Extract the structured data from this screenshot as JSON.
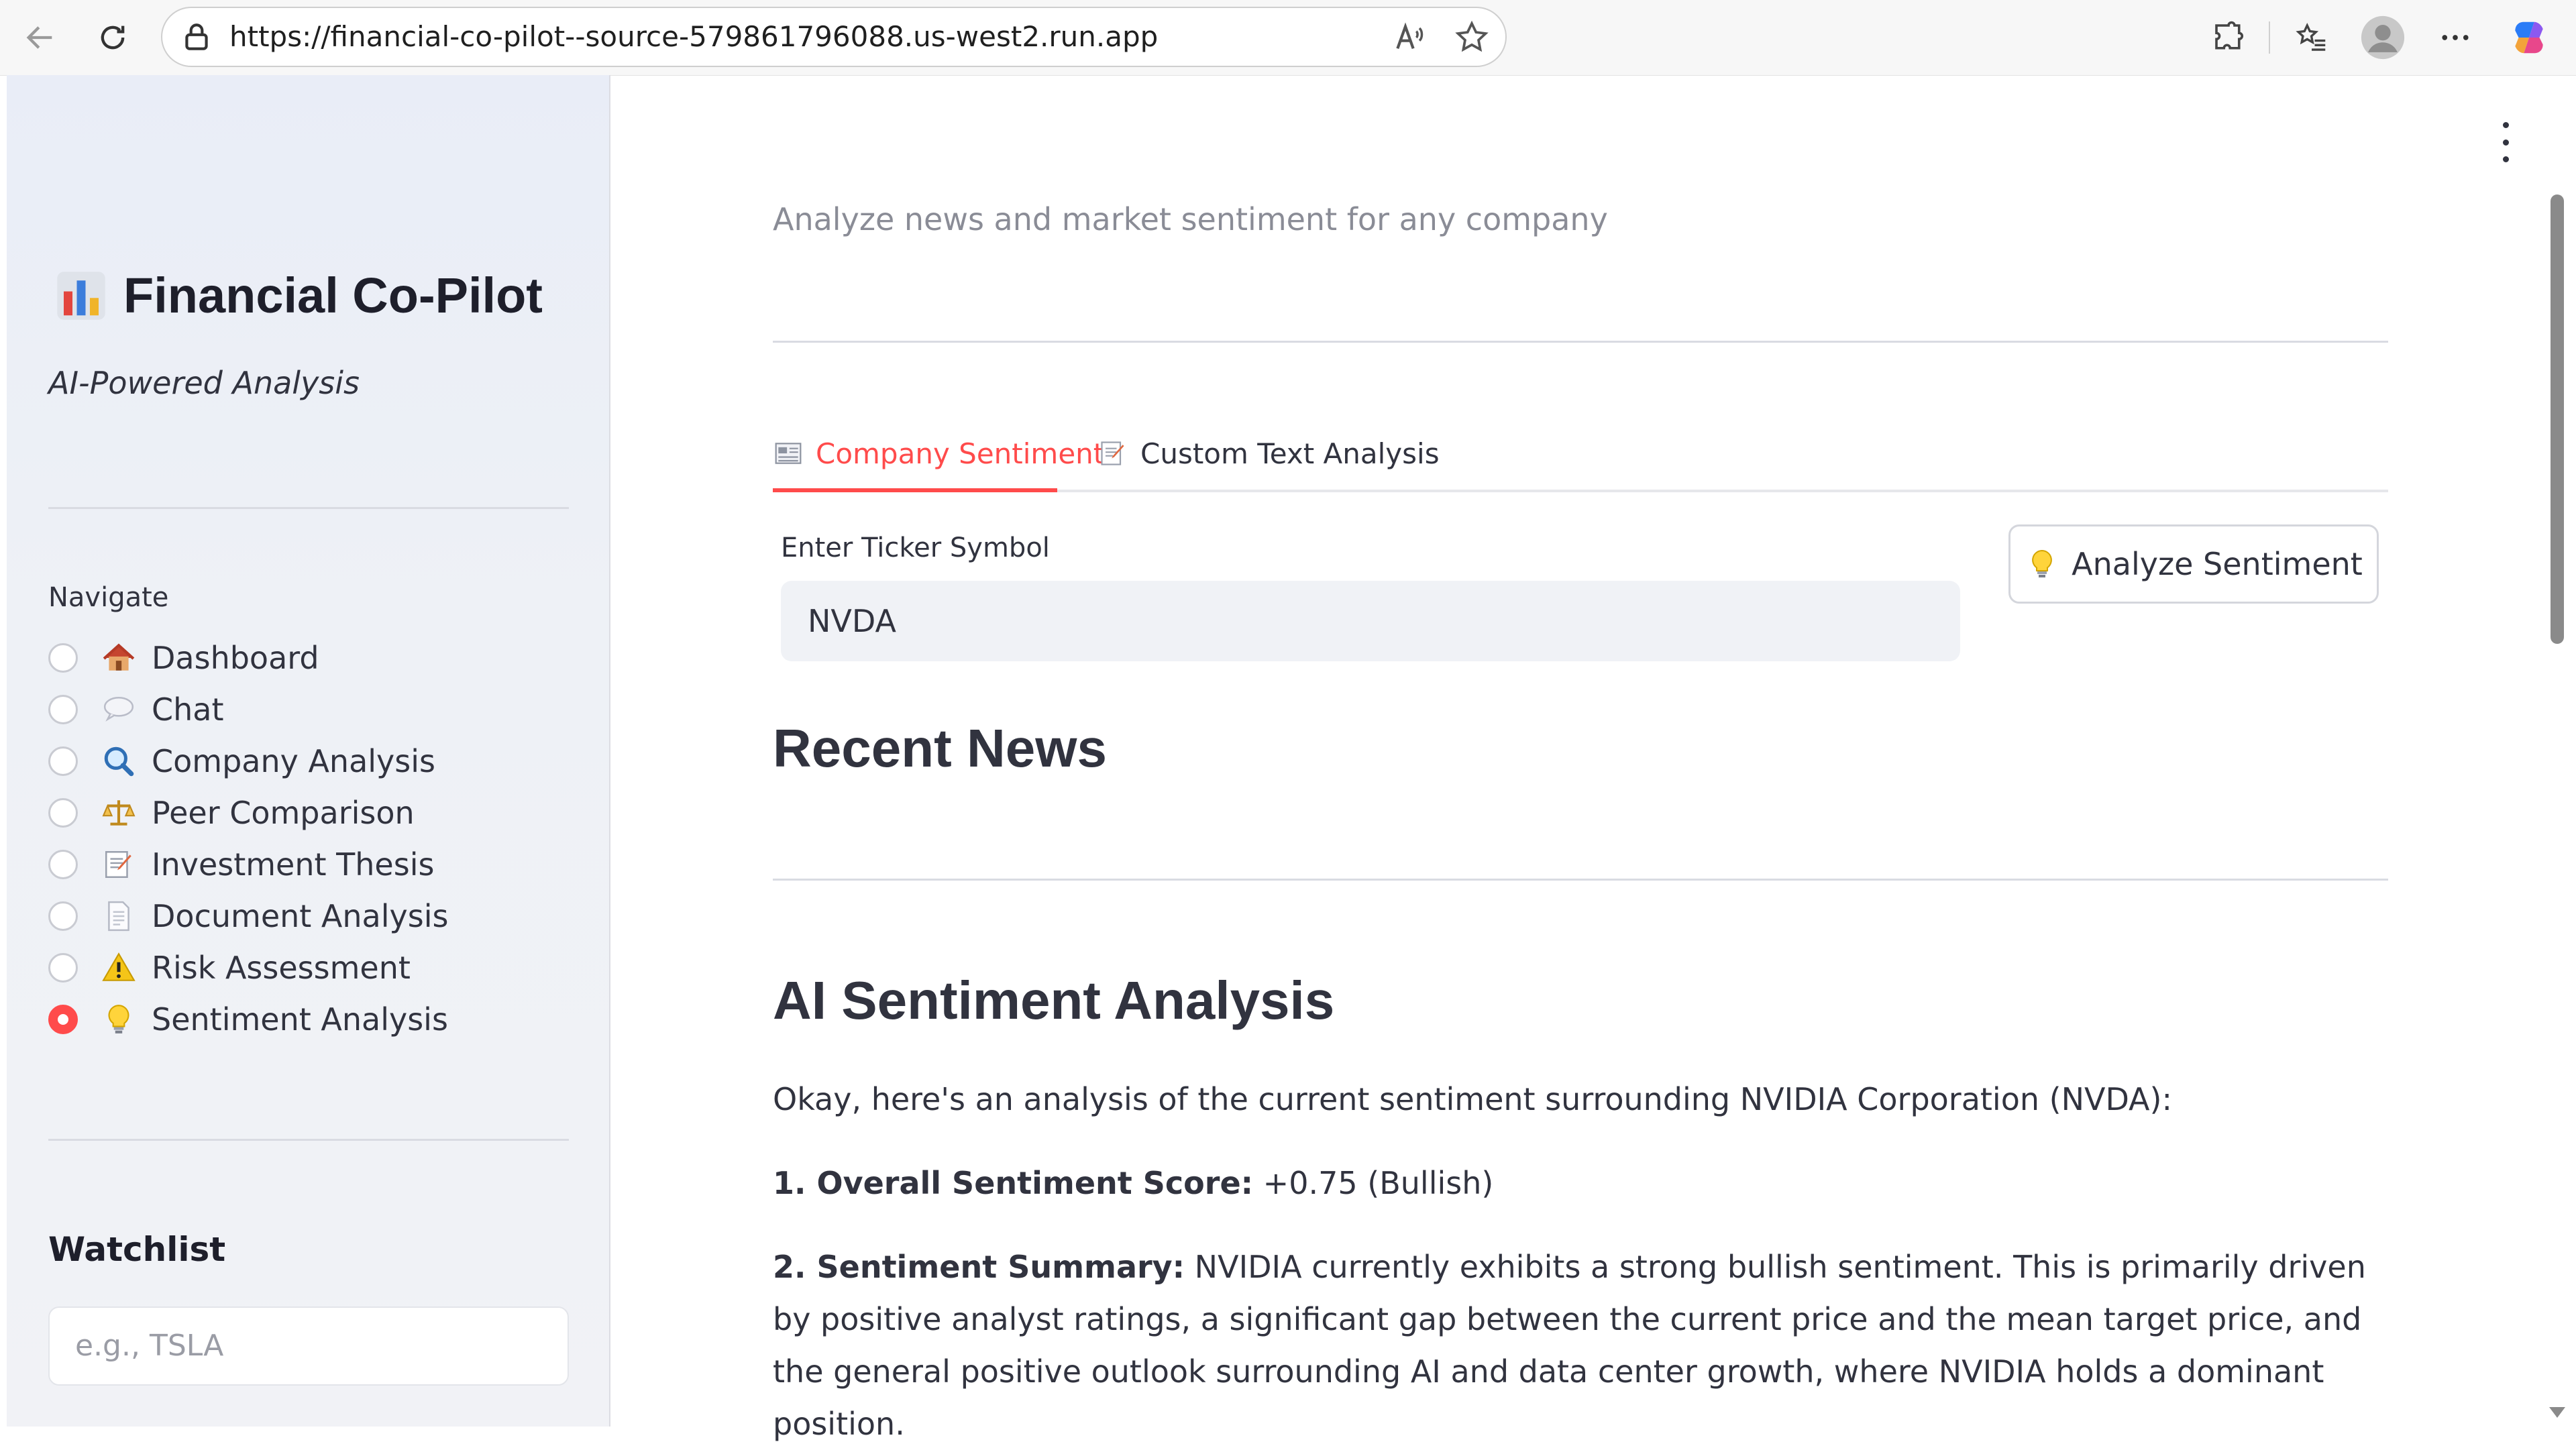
{
  "browser": {
    "url": "https://financial-co-pilot--source-579861796088.us-west2.run.app"
  },
  "sidebar": {
    "brand_title": "Financial Co-Pilot",
    "tagline": "AI-Powered Analysis",
    "nav_label": "Navigate",
    "nav_items": [
      {
        "label": "Dashboard",
        "icon": "house-icon",
        "selected": false
      },
      {
        "label": "Chat",
        "icon": "speech-bubble-icon",
        "selected": false
      },
      {
        "label": "Company Analysis",
        "icon": "magnifier-icon",
        "selected": false
      },
      {
        "label": "Peer Comparison",
        "icon": "scales-icon",
        "selected": false
      },
      {
        "label": "Investment Thesis",
        "icon": "memo-icon",
        "selected": false
      },
      {
        "label": "Document Analysis",
        "icon": "document-icon",
        "selected": false
      },
      {
        "label": "Risk Assessment",
        "icon": "warning-icon",
        "selected": false
      },
      {
        "label": "Sentiment Analysis",
        "icon": "lightbulb-icon",
        "selected": true
      }
    ],
    "watchlist_title": "Watchlist",
    "watchlist_placeholder": "e.g., TSLA"
  },
  "main": {
    "subtitle": "Analyze news and market sentiment for any company",
    "tabs": [
      {
        "label": "Company Sentiment",
        "icon": "newspaper-icon",
        "active": true
      },
      {
        "label": "Custom Text Analysis",
        "icon": "memo-icon",
        "active": false
      }
    ],
    "ticker_label": "Enter Ticker Symbol",
    "ticker_value": "NVDA",
    "analyze_button": "Analyze Sentiment",
    "recent_news_heading": "Recent News",
    "ai_heading": "AI Sentiment Analysis",
    "intro": "Okay, here's an analysis of the current sentiment surrounding NVIDIA Corporation (NVDA):",
    "score_label": "1. Overall Sentiment Score:",
    "score_value": " +0.75 (Bullish)",
    "summary_label": "2. Sentiment Summary:",
    "summary_text": " NVIDIA currently exhibits a strong bullish sentiment. This is primarily driven by positive analyst ratings, a significant gap between the current price and the mean target price, and the general positive outlook surrounding AI and data center growth, where NVIDIA holds a dominant position."
  },
  "colors": {
    "accent": "#ff4b4b",
    "sidebar_bg": "#eef1f6",
    "text": "#31333f"
  }
}
